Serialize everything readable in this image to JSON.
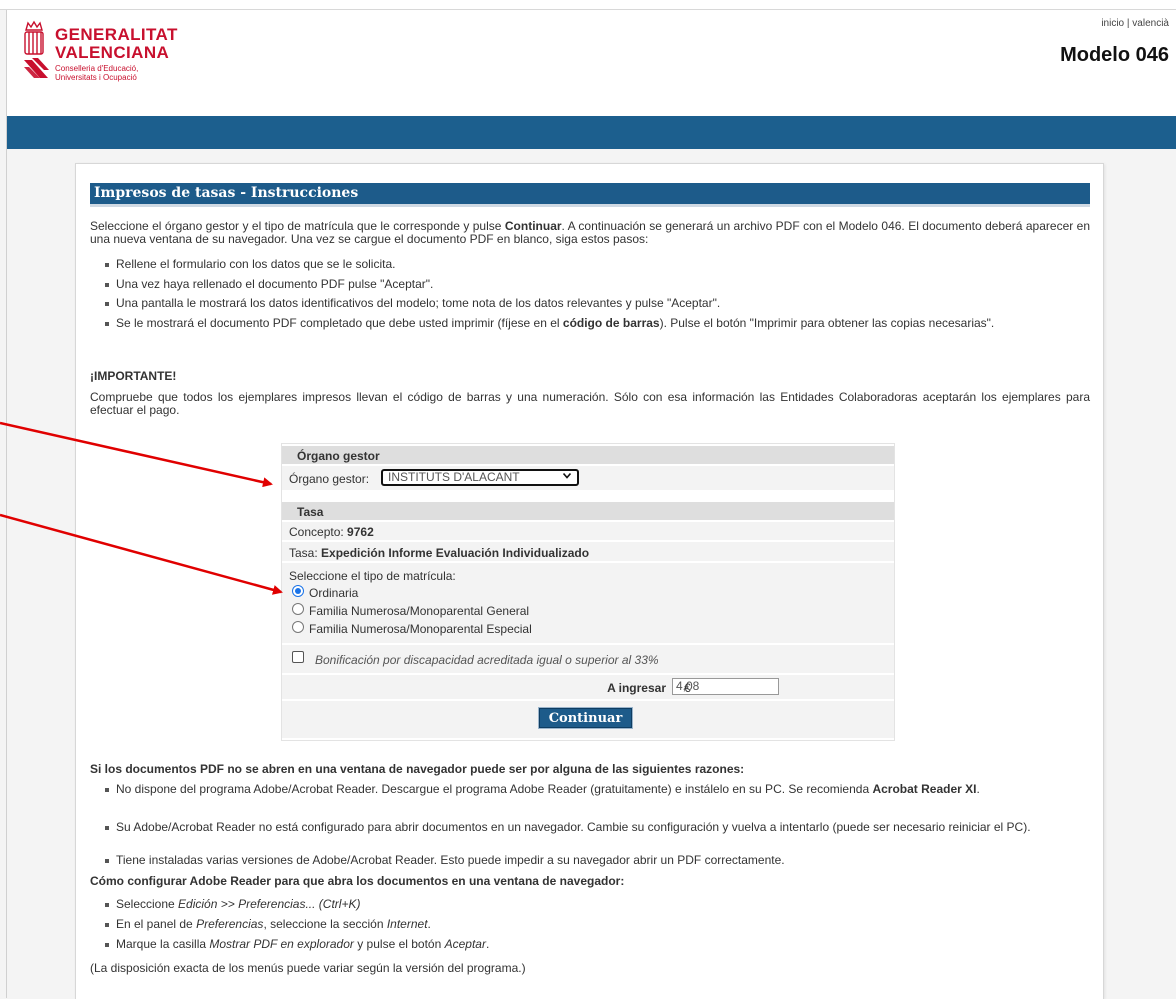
{
  "header": {
    "logo_line1": "GENERALITAT",
    "logo_line2": "VALENCIANA",
    "logo_sub1": "Conselleria d'Educació,",
    "logo_sub2": "Universitats i Ocupació",
    "link_inicio": "inicio",
    "link_separator": "|",
    "link_valencia": "valencià",
    "page_title": "Modelo 046"
  },
  "colors": {
    "band": "#1c5f8e",
    "brand_red": "#c8102e",
    "arrow_red": "#e00000"
  },
  "section_title": "Impresos de tasas - Instrucciones",
  "intro": {
    "p1": "Seleccione el órgano gestor y el tipo de matrícula que le corresponde y pulse ",
    "p1_bold": "Continuar",
    "p1_end": ". A continuación se generará un archivo PDF con el Modelo 046. El documento deberá aparecer en una nueva ventana de su navegador. Una vez se cargue el documento PDF en blanco, siga estos pasos:"
  },
  "steps": [
    "Rellene el formulario con los datos que se le solicita.",
    "Una vez haya rellenado el documento PDF pulse \"Aceptar\".",
    "Una pantalla le mostrará los datos identificativos del modelo; tome nota de los datos relevantes y pulse \"Aceptar\"."
  ],
  "step4": {
    "a": "Se le mostrará el documento PDF completado que debe usted imprimir (fíjese en el ",
    "b": "código de barras",
    "c": "). Pulse el botón \"Imprimir para obtener las copias necesarias\"."
  },
  "important": {
    "title": "¡IMPORTANTE!",
    "text": "Compruebe que todos los ejemplares impresos llevan el código de barras y una numeración. Sólo con esa información las Entidades Colaboradoras aceptarán los ejemplares para efectuar el pago."
  },
  "form": {
    "organo_header": "Órgano gestor",
    "organo_label": "Órgano gestor:",
    "organo_value": "INSTITUTS D'ALACANT",
    "tasa_header": "Tasa",
    "concepto_label": "Concepto:",
    "concepto_value": "9762",
    "tasa_label": "Tasa:",
    "tasa_value": "Expedición Informe Evaluación Individualizado",
    "matricula_label": "Seleccione el tipo de matrícula:",
    "options": [
      "Ordinaria",
      "Familia Numerosa/Monoparental General",
      "Familia Numerosa/Monoparental Especial"
    ],
    "selected_option": "Ordinaria",
    "bonificacion": "Bonificación por discapacidad acreditada igual o superior al 33%",
    "ingresar_label": "A ingresar",
    "ingresar_value": "4,08",
    "currency": "€",
    "continue_button": "Continuar"
  },
  "pdf_help": {
    "title": "Si los documentos PDF no se abren en una ventana de navegador puede ser por alguna de las siguientes razones:",
    "r1a": "No dispone del programa Adobe/Acrobat Reader. Descargue el programa Adobe Reader (gratuitamente) e instálelo en su PC. Se recomienda ",
    "r1b": "Acrobat Reader XI",
    "r1c": ".",
    "r2": "Su Adobe/Acrobat Reader no está configurado para abrir documentos en un navegador. Cambie su configuración y vuelva a intentarlo (puede ser necesario reiniciar el PC).",
    "r3": "Tiene instaladas varias versiones de Adobe/Acrobat Reader. Esto puede impedir a su navegador abrir un PDF correctamente.",
    "config_title": "Cómo configurar Adobe Reader para que abra los documentos en una ventana de navegador:",
    "c1a": "Seleccione ",
    "c1b": "Edición >> Preferencias... (Ctrl+K)",
    "c2a": "En el panel de ",
    "c2b": "Preferencias",
    "c2c": ", seleccione la sección ",
    "c2d": "Internet",
    "c2e": ".",
    "c3a": "Marque la casilla ",
    "c3b": "Mostrar PDF en explorador",
    "c3c": " y pulse el botón ",
    "c3d": "Aceptar",
    "c3e": ".",
    "note": "(La disposición exacta de los menús puede variar según la versión del programa.)"
  }
}
